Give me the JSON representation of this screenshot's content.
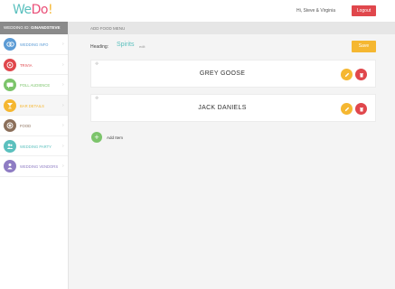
{
  "header": {
    "logo_we": "We",
    "logo_do": "Do",
    "logo_ex": "!",
    "greeting": "Hi, Steve & Virginia",
    "logout_label": "Logout"
  },
  "sidebar": {
    "wedding_id_label": "WEDDING ID:",
    "wedding_id_value": "GINANDSTEVE",
    "items": [
      {
        "label": "WEDDING INFO",
        "icon": "rings-icon",
        "color": "#5b9bd5"
      },
      {
        "label": "TRIVIA",
        "icon": "trivia-icon",
        "color": "#e0474c"
      },
      {
        "label": "POLL AUDIENCE",
        "icon": "chat-icon",
        "color": "#7cc46b"
      },
      {
        "label": "BAR DETAILS",
        "icon": "glass-icon",
        "color": "#f5b731"
      },
      {
        "label": "FOOD",
        "icon": "food-icon",
        "color": "#8b6f5a"
      },
      {
        "label": "WEDDING PARTY",
        "icon": "party-icon",
        "color": "#5bc0be"
      },
      {
        "label": "WEDDING VENDORS",
        "icon": "vendors-icon",
        "color": "#8e7cc3"
      }
    ]
  },
  "breadcrumb": "ADD FOOD MENU",
  "section": {
    "heading_label": "Heading:",
    "heading_value": "Spirits",
    "edit_label": "edit",
    "save_label": "Save"
  },
  "items": [
    {
      "name": "GREY GOOSE"
    },
    {
      "name": "JACK DANIELS"
    }
  ],
  "add_item_label": "Add Item",
  "colors": {
    "accent_teal": "#5bc0be",
    "accent_red": "#e0474c",
    "accent_yellow": "#f5b731",
    "accent_green": "#7cc46b"
  }
}
